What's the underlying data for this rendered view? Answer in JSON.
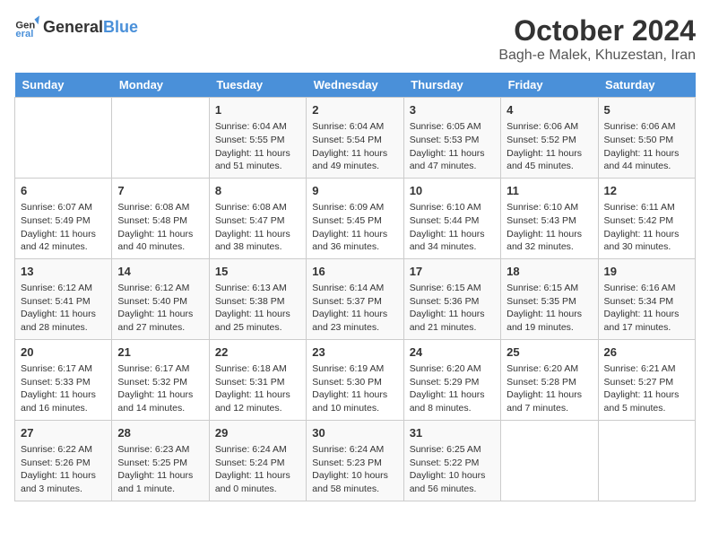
{
  "header": {
    "logo_general": "General",
    "logo_blue": "Blue",
    "main_title": "October 2024",
    "subtitle": "Bagh-e Malek, Khuzestan, Iran"
  },
  "days_of_week": [
    "Sunday",
    "Monday",
    "Tuesday",
    "Wednesday",
    "Thursday",
    "Friday",
    "Saturday"
  ],
  "weeks": [
    [
      {
        "day": "",
        "content": ""
      },
      {
        "day": "",
        "content": ""
      },
      {
        "day": "1",
        "content": "Sunrise: 6:04 AM\nSunset: 5:55 PM\nDaylight: 11 hours and 51 minutes."
      },
      {
        "day": "2",
        "content": "Sunrise: 6:04 AM\nSunset: 5:54 PM\nDaylight: 11 hours and 49 minutes."
      },
      {
        "day": "3",
        "content": "Sunrise: 6:05 AM\nSunset: 5:53 PM\nDaylight: 11 hours and 47 minutes."
      },
      {
        "day": "4",
        "content": "Sunrise: 6:06 AM\nSunset: 5:52 PM\nDaylight: 11 hours and 45 minutes."
      },
      {
        "day": "5",
        "content": "Sunrise: 6:06 AM\nSunset: 5:50 PM\nDaylight: 11 hours and 44 minutes."
      }
    ],
    [
      {
        "day": "6",
        "content": "Sunrise: 6:07 AM\nSunset: 5:49 PM\nDaylight: 11 hours and 42 minutes."
      },
      {
        "day": "7",
        "content": "Sunrise: 6:08 AM\nSunset: 5:48 PM\nDaylight: 11 hours and 40 minutes."
      },
      {
        "day": "8",
        "content": "Sunrise: 6:08 AM\nSunset: 5:47 PM\nDaylight: 11 hours and 38 minutes."
      },
      {
        "day": "9",
        "content": "Sunrise: 6:09 AM\nSunset: 5:45 PM\nDaylight: 11 hours and 36 minutes."
      },
      {
        "day": "10",
        "content": "Sunrise: 6:10 AM\nSunset: 5:44 PM\nDaylight: 11 hours and 34 minutes."
      },
      {
        "day": "11",
        "content": "Sunrise: 6:10 AM\nSunset: 5:43 PM\nDaylight: 11 hours and 32 minutes."
      },
      {
        "day": "12",
        "content": "Sunrise: 6:11 AM\nSunset: 5:42 PM\nDaylight: 11 hours and 30 minutes."
      }
    ],
    [
      {
        "day": "13",
        "content": "Sunrise: 6:12 AM\nSunset: 5:41 PM\nDaylight: 11 hours and 28 minutes."
      },
      {
        "day": "14",
        "content": "Sunrise: 6:12 AM\nSunset: 5:40 PM\nDaylight: 11 hours and 27 minutes."
      },
      {
        "day": "15",
        "content": "Sunrise: 6:13 AM\nSunset: 5:38 PM\nDaylight: 11 hours and 25 minutes."
      },
      {
        "day": "16",
        "content": "Sunrise: 6:14 AM\nSunset: 5:37 PM\nDaylight: 11 hours and 23 minutes."
      },
      {
        "day": "17",
        "content": "Sunrise: 6:15 AM\nSunset: 5:36 PM\nDaylight: 11 hours and 21 minutes."
      },
      {
        "day": "18",
        "content": "Sunrise: 6:15 AM\nSunset: 5:35 PM\nDaylight: 11 hours and 19 minutes."
      },
      {
        "day": "19",
        "content": "Sunrise: 6:16 AM\nSunset: 5:34 PM\nDaylight: 11 hours and 17 minutes."
      }
    ],
    [
      {
        "day": "20",
        "content": "Sunrise: 6:17 AM\nSunset: 5:33 PM\nDaylight: 11 hours and 16 minutes."
      },
      {
        "day": "21",
        "content": "Sunrise: 6:17 AM\nSunset: 5:32 PM\nDaylight: 11 hours and 14 minutes."
      },
      {
        "day": "22",
        "content": "Sunrise: 6:18 AM\nSunset: 5:31 PM\nDaylight: 11 hours and 12 minutes."
      },
      {
        "day": "23",
        "content": "Sunrise: 6:19 AM\nSunset: 5:30 PM\nDaylight: 11 hours and 10 minutes."
      },
      {
        "day": "24",
        "content": "Sunrise: 6:20 AM\nSunset: 5:29 PM\nDaylight: 11 hours and 8 minutes."
      },
      {
        "day": "25",
        "content": "Sunrise: 6:20 AM\nSunset: 5:28 PM\nDaylight: 11 hours and 7 minutes."
      },
      {
        "day": "26",
        "content": "Sunrise: 6:21 AM\nSunset: 5:27 PM\nDaylight: 11 hours and 5 minutes."
      }
    ],
    [
      {
        "day": "27",
        "content": "Sunrise: 6:22 AM\nSunset: 5:26 PM\nDaylight: 11 hours and 3 minutes."
      },
      {
        "day": "28",
        "content": "Sunrise: 6:23 AM\nSunset: 5:25 PM\nDaylight: 11 hours and 1 minute."
      },
      {
        "day": "29",
        "content": "Sunrise: 6:24 AM\nSunset: 5:24 PM\nDaylight: 11 hours and 0 minutes."
      },
      {
        "day": "30",
        "content": "Sunrise: 6:24 AM\nSunset: 5:23 PM\nDaylight: 10 hours and 58 minutes."
      },
      {
        "day": "31",
        "content": "Sunrise: 6:25 AM\nSunset: 5:22 PM\nDaylight: 10 hours and 56 minutes."
      },
      {
        "day": "",
        "content": ""
      },
      {
        "day": "",
        "content": ""
      }
    ]
  ]
}
